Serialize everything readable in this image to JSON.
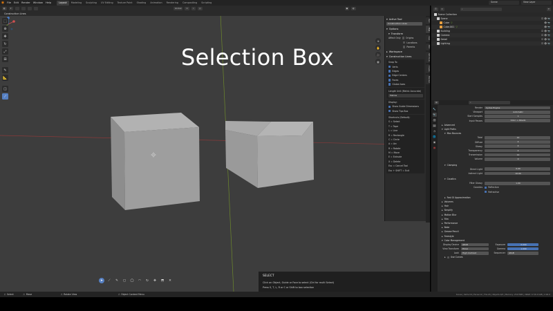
{
  "app": {
    "menus": [
      "File",
      "Edit",
      "Render",
      "Window",
      "Help"
    ],
    "workspaces": [
      {
        "label": "Layout",
        "active": true
      },
      {
        "label": "Modeling",
        "active": false
      },
      {
        "label": "Sculpting",
        "active": false
      },
      {
        "label": "UV Editing",
        "active": false
      },
      {
        "label": "Texture Paint",
        "active": false
      },
      {
        "label": "Shading",
        "active": false
      },
      {
        "label": "Animation",
        "active": false
      },
      {
        "label": "Rendering",
        "active": false
      },
      {
        "label": "Compositing",
        "active": false
      },
      {
        "label": "Scripting",
        "active": false
      }
    ],
    "scene_label": "Scene",
    "view_layer_label": "View Layer"
  },
  "viewport": {
    "tool_name": "Construction Lines",
    "overlay_title": "Selection Box",
    "header_mode": "Global",
    "colors": {
      "background": "#3d3d3d",
      "cube_light": "#b5b5b5",
      "cube_mid": "#9a9a9a",
      "cube_dark": "#8a8a8a",
      "accent": "#5680c2"
    }
  },
  "n_panel": {
    "active_tool_title": "Active Tool",
    "active_tool_value": "Construction Lines",
    "options_title": "Options",
    "transform_title": "Transform",
    "affect_only_label": "Affect Only",
    "affect_only_items": [
      "Origins",
      "Locations",
      "Parents"
    ],
    "workspace_title": "Workspace",
    "construction_lines_title": "Construction Lines",
    "snap_to_title": "Snap To:",
    "snap_items": [
      "Verts",
      "Edges",
      "Edge Centers",
      "Faces",
      "Global Axes"
    ],
    "length_unit_title": "Length Unit (Metric Accurate)",
    "length_unit_value": "Metres",
    "display_title": "Display:",
    "display_items": [
      "Show Guide Dimensions",
      "Show Tips Box"
    ],
    "shortcuts_title": "Shortcuts (Default):",
    "shortcuts": [
      "S = Select",
      "T = Tape",
      "L = Line",
      "R = Rectangle",
      "C = Circle",
      "A = Arc",
      "R = Rotate",
      "M = Move",
      "E = Extrude",
      "X = Delete",
      "Esc = Cancel Tool",
      "Esc + SHIFT = Exit"
    ],
    "side_tabs": [
      "Item",
      "Tool",
      "View",
      "Edit",
      "SIM Tools",
      "Create",
      "Blender"
    ]
  },
  "select_panel": {
    "title": "SELECT",
    "line1": "Click an Object, Guide or Face to select (Ctrl for multi Select)",
    "line2": "Press S, T, L, R or C or Shift to box selection"
  },
  "outliner": {
    "search_placeholder": "",
    "rows": [
      {
        "label": "Scene Collection",
        "indent": 0,
        "color": "#cfcfcf"
      },
      {
        "label": "Scene",
        "indent": 1,
        "color": "#cfcfcf"
      },
      {
        "label": "Cube",
        "indent": 2,
        "color": "#e8a040"
      },
      {
        "label": "Cube.001",
        "indent": 2,
        "color": "#e8a040"
      },
      {
        "label": "Building",
        "indent": 1,
        "color": "#cfcfcf"
      },
      {
        "label": "Camera",
        "indent": 1,
        "color": "#cfcfcf"
      },
      {
        "label": "Detail",
        "indent": 1,
        "color": "#cfcfcf"
      },
      {
        "label": "Lighting",
        "indent": 1,
        "color": "#cfcfcf"
      }
    ]
  },
  "properties": {
    "render_engine_label": "Render",
    "render_engine": "Cycles Engine",
    "rows": [
      {
        "kind": "field",
        "label": "Viewport",
        "value": "Automatic"
      },
      {
        "kind": "field",
        "label": "Start Samples",
        "value": "1"
      },
      {
        "kind": "field",
        "label": "Input Passes",
        "value": "Color + Albedo"
      },
      {
        "kind": "section",
        "label": "Advanced"
      },
      {
        "kind": "section",
        "label": "Light Paths"
      },
      {
        "kind": "sub",
        "label": "Max Bounces"
      },
      {
        "kind": "field",
        "label": "Total",
        "value": "12"
      },
      {
        "kind": "field",
        "label": "Diffuse",
        "value": "4"
      },
      {
        "kind": "field",
        "label": "Glossy",
        "value": "4"
      },
      {
        "kind": "field",
        "label": "Transparency",
        "value": "4"
      },
      {
        "kind": "field",
        "label": "Transmission",
        "value": "12"
      },
      {
        "kind": "field",
        "label": "Volume",
        "value": "0"
      },
      {
        "kind": "blank"
      },
      {
        "kind": "sub",
        "label": "Clamping"
      },
      {
        "kind": "field",
        "label": "Direct Light",
        "value": "0.00"
      },
      {
        "kind": "field",
        "label": "Indirect Light",
        "value": "10.00"
      },
      {
        "kind": "blank"
      },
      {
        "kind": "sub",
        "label": "Caustics"
      },
      {
        "kind": "field",
        "label": "Filter Glossy",
        "value": "1.00"
      },
      {
        "kind": "check",
        "label": "Caustics",
        "value": "Reflective"
      },
      {
        "kind": "check",
        "label": "",
        "value": "Refractive"
      },
      {
        "kind": "blank"
      },
      {
        "kind": "sub",
        "label": "Fast GI Approximation"
      },
      {
        "kind": "section",
        "label": "Volumes"
      },
      {
        "kind": "section",
        "label": "Hair"
      },
      {
        "kind": "section",
        "label": "Simplify"
      },
      {
        "kind": "section",
        "label": "Motion Blur"
      },
      {
        "kind": "section",
        "label": "Film"
      },
      {
        "kind": "section",
        "label": "Performance"
      },
      {
        "kind": "section",
        "label": "Bake"
      },
      {
        "kind": "section",
        "label": "Grease Pencil"
      },
      {
        "kind": "section",
        "label": "Freestyle"
      },
      {
        "kind": "section",
        "label": "Color Management"
      }
    ],
    "color_mgmt": {
      "display_device_label": "Display Device",
      "display_device": "sRGB",
      "view_transform_label": "View Transform",
      "view_transform": "Filmic",
      "look_label": "Look",
      "look": "High Contrast",
      "exposure_label": "Exposure",
      "exposure": "0.000",
      "gamma_label": "Gamma",
      "gamma": "1.000",
      "sequencer_label": "Sequencer",
      "sequencer": "sRGB",
      "use_curves_label": "Use Curves"
    }
  },
  "statusbar": {
    "select_label": "Select",
    "move_label": "Move",
    "rotate_label": "Rotate View",
    "context_label": "Object Context Menu",
    "version": "Scene | Verts:16 | Faces:12 | Tris:24 | Objects:0/2 | Memory: 25.8 MiB | VRAM: 0.7/6.0 GiB | 2.92.0"
  }
}
